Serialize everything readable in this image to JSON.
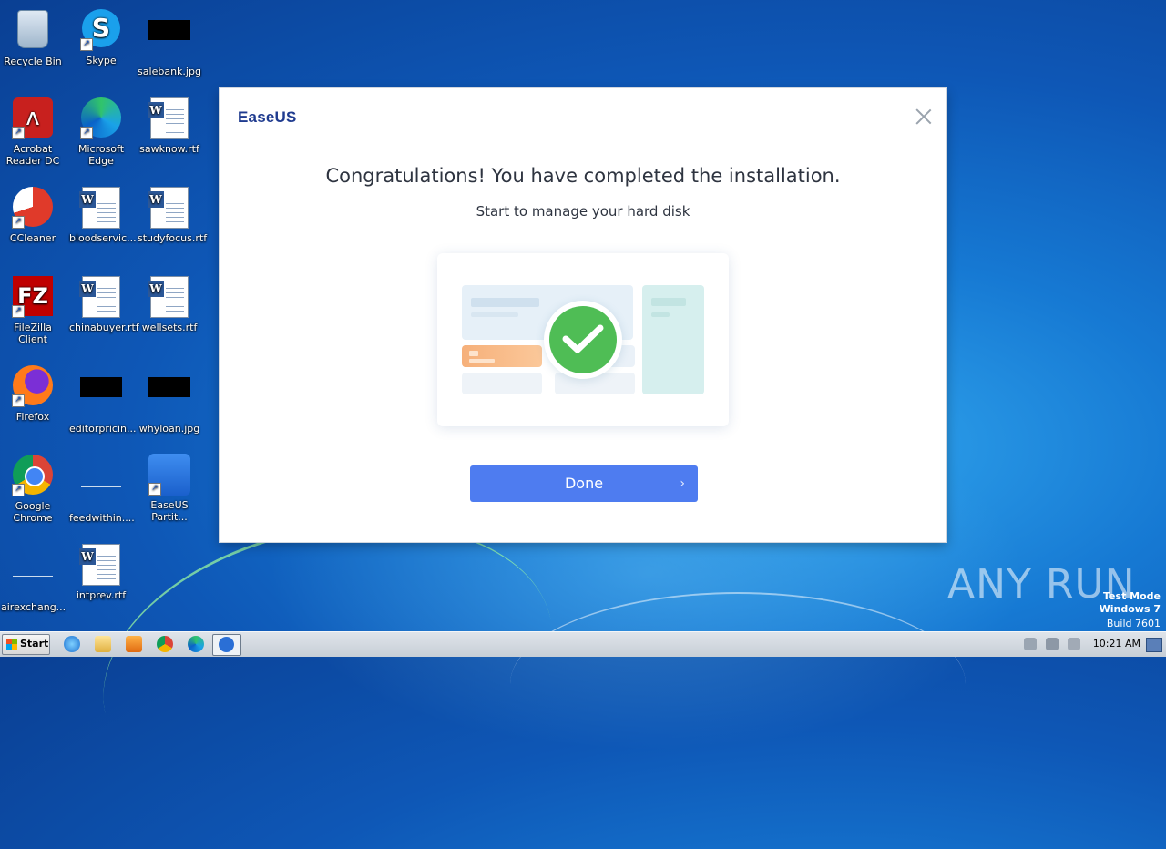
{
  "desktop": {
    "icons": [
      {
        "label": "Recycle Bin"
      },
      {
        "label": "Skype"
      },
      {
        "label": "salebank.jpg"
      },
      {
        "label": "Acrobat Reader DC"
      },
      {
        "label": "Microsoft Edge"
      },
      {
        "label": "sawknow.rtf"
      },
      {
        "label": "CCleaner"
      },
      {
        "label": "bloodservic..."
      },
      {
        "label": "studyfocus.rtf"
      },
      {
        "label": "FileZilla Client"
      },
      {
        "label": "chinabuyer.rtf"
      },
      {
        "label": "wellsets.rtf"
      },
      {
        "label": "Firefox"
      },
      {
        "label": "editorpricin..."
      },
      {
        "label": "whyloan.jpg"
      },
      {
        "label": "Google Chrome"
      },
      {
        "label": "feedwithin...."
      },
      {
        "label": "EaseUS Partit..."
      },
      {
        "label": "airexchang..."
      },
      {
        "label": "intprev.rtf"
      }
    ]
  },
  "dialog": {
    "logo": "EaseUS",
    "title": "Congratulations! You have completed the installation.",
    "subtitle": "Start to manage your hard disk",
    "done_label": "Done",
    "done_chevron": "›",
    "accent_color": "#4e7cf0",
    "success_color": "#4fbd55"
  },
  "taskbar": {
    "start_label": "Start",
    "clock": "10:21 AM"
  },
  "watermark": {
    "brand": "ANY RUN",
    "line1": "Test Mode",
    "line2": "Windows 7",
    "line3": "Build 7601"
  }
}
